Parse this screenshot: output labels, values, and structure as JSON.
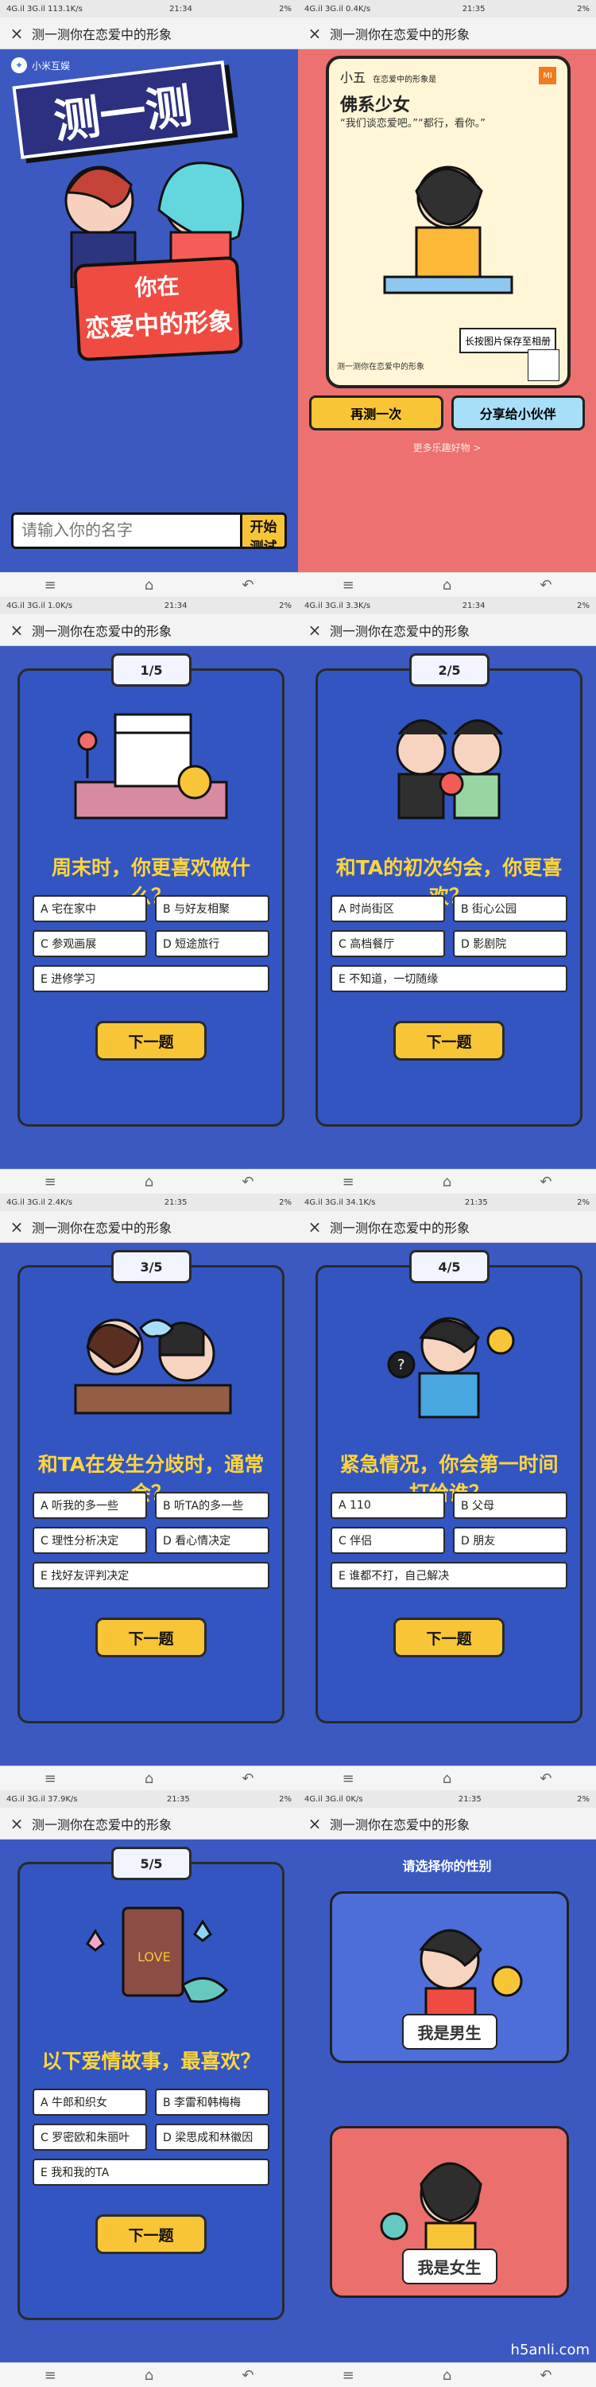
{
  "screens": {
    "intro": {
      "status": {
        "left": "4G.il 3G.il 113.1K/s",
        "time": "21:34",
        "right": "2%"
      },
      "title": "测一测你在恋爱中的形象",
      "brand": "小米互娱",
      "hero": "测一测",
      "main_line1": "你在",
      "main_line2": "恋爱中的形象",
      "input_placeholder": "请输入你的名字",
      "button": "开始测试",
      "colors": {
        "bg": "#3c59c2",
        "accent": "#f8c536",
        "badge": "#f04b41"
      }
    },
    "result": {
      "status": {
        "left": "4G.il 3G.il 0.4K/s",
        "time": "21:35",
        "right": "2%"
      },
      "title": "测一测你在恋爱中的形象",
      "name": "小五",
      "subtitle": "在恋爱中的形象是",
      "type": "佛系少女",
      "quote": "“我们谈恋爱吧。”“都行，看你。”",
      "logo": "MI",
      "save_tip": "长按图片保存至相册",
      "footer": "测一测你在恋爱中的形象",
      "btn_retry": "再测一次",
      "btn_share": "分享给小伙伴",
      "more": "更多乐趣好物 >",
      "colors": {
        "bg": "#ec7170",
        "card": "#fff6d7",
        "retry": "#f8c536",
        "share": "#a8dff8"
      }
    },
    "q1": {
      "status": {
        "left": "4G.il 3G.il 1.0K/s",
        "time": "21:34",
        "right": "2%"
      },
      "title": "测一测你在恋爱中的形象",
      "progress": "1/5",
      "question": "周末时，你更喜欢做什么？",
      "options": [
        "A 宅在家中",
        "B 与好友相聚",
        "C 参观画展",
        "D 短途旅行",
        "E 进修学习"
      ],
      "button": "下一题"
    },
    "q2": {
      "status": {
        "left": "4G.il 3G.il 3.3K/s",
        "time": "21:34",
        "right": "2%"
      },
      "title": "测一测你在恋爱中的形象",
      "progress": "2/5",
      "question": "和TA的初次约会，你更喜欢？",
      "options": [
        "A 时尚街区",
        "B 街心公园",
        "C 高档餐厅",
        "D 影剧院",
        "E 不知道，一切随缘"
      ],
      "button": "下一题"
    },
    "q3": {
      "status": {
        "left": "4G.il 3G.il 2.4K/s",
        "time": "21:35",
        "right": "2%"
      },
      "title": "测一测你在恋爱中的形象",
      "progress": "3/5",
      "question": "和TA在发生分歧时，通常会？",
      "options": [
        "A 听我的多一些",
        "B 听TA的多一些",
        "C 理性分析决定",
        "D 看心情决定",
        "E 找好友评判决定"
      ],
      "button": "下一题"
    },
    "q4": {
      "status": {
        "left": "4G.il 3G.il 34.1K/s",
        "time": "21:35",
        "right": "2%"
      },
      "title": "测一测你在恋爱中的形象",
      "progress": "4/5",
      "question": "紧急情况，你会第一时间打给谁？",
      "options": [
        "A 110",
        "B 父母",
        "C 伴侣",
        "D 朋友",
        "E 谁都不打，自己解决"
      ],
      "button": "下一题"
    },
    "q5": {
      "status": {
        "left": "4G.il 3G.il 37.9K/s",
        "time": "21:35",
        "right": "2%"
      },
      "title": "测一测你在恋爱中的形象",
      "progress": "5/5",
      "question": "以下爱情故事，最喜欢？",
      "options": [
        "A 牛郎和织女",
        "B 李雷和韩梅梅",
        "C 罗密欧和朱丽叶",
        "D 梁思成和林徽因",
        "E 我和我的TA"
      ],
      "button": "下一题"
    },
    "gender": {
      "status": {
        "left": "4G.il 3G.il 0K/s",
        "time": "21:35",
        "right": "2%"
      },
      "title": "测一测你在恋爱中的形象",
      "heading": "请选择你的性别",
      "male": "我是男生",
      "female": "我是女生"
    }
  },
  "watermark": "h5anli.com"
}
